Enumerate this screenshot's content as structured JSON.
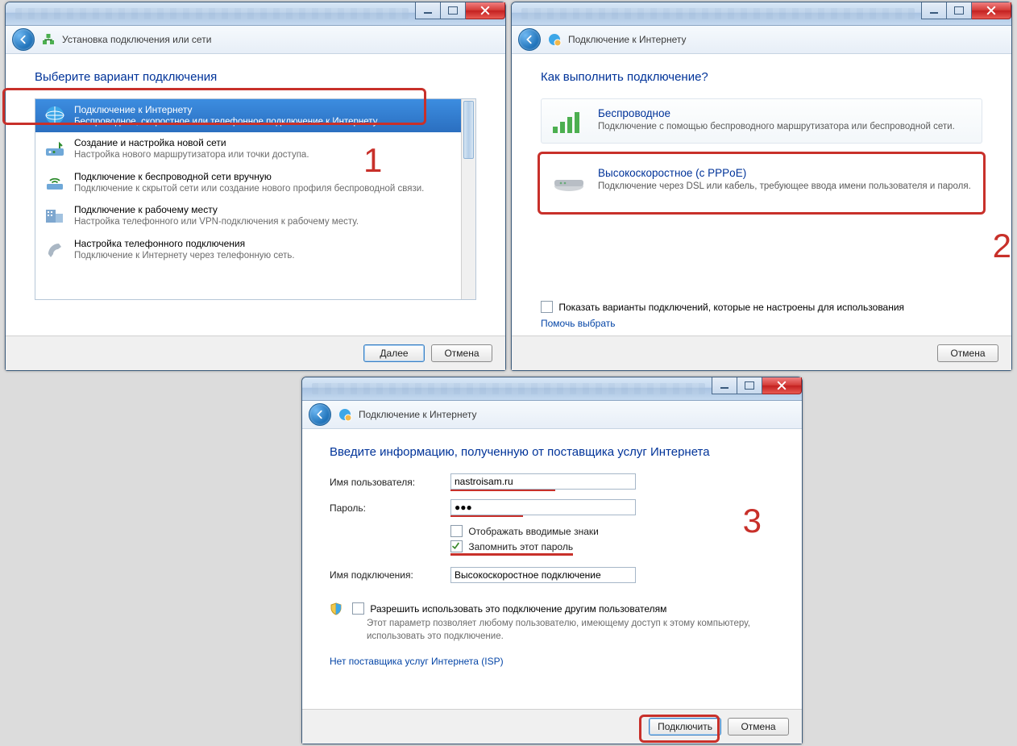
{
  "annotations": {
    "step1": "1",
    "step2": "2",
    "step3": "3"
  },
  "window1": {
    "header_title": "Установка подключения или сети",
    "heading": "Выберите вариант подключения",
    "options": [
      {
        "title": "Подключение к Интернету",
        "desc": "Беспроводное, скоростное или телефонное подключение к Интернету."
      },
      {
        "title": "Создание и настройка новой сети",
        "desc": "Настройка нового маршрутизатора или точки доступа."
      },
      {
        "title": "Подключение к беспроводной сети вручную",
        "desc": "Подключение к скрытой сети или создание нового профиля беспроводной связи."
      },
      {
        "title": "Подключение к рабочему месту",
        "desc": "Настройка телефонного или VPN-подключения к рабочему месту."
      },
      {
        "title": "Настройка телефонного подключения",
        "desc": "Подключение к Интернету через телефонную сеть."
      }
    ],
    "next": "Далее",
    "cancel": "Отмена"
  },
  "window2": {
    "header_title": "Подключение к Интернету",
    "heading": "Как выполнить подключение?",
    "wireless_title": "Беспроводное",
    "wireless_desc": "Подключение с помощью беспроводного маршрутизатора или беспроводной сети.",
    "pppoe_title": "Высокоскоростное (с PPPoE)",
    "pppoe_desc": "Подключение через DSL или кабель, требующее ввода имени пользователя и пароля.",
    "show_unconfigured": "Показать варианты подключений, которые не настроены для использования",
    "help_choose": "Помочь выбрать",
    "cancel": "Отмена"
  },
  "window3": {
    "header_title": "Подключение к Интернету",
    "heading": "Введите информацию, полученную от поставщика услуг Интернета",
    "label_user": "Имя пользователя:",
    "value_user": "nastroisam.ru",
    "label_pass": "Пароль:",
    "value_pass": "●●●",
    "show_chars": "Отображать вводимые знаки",
    "remember": "Запомнить этот пароль",
    "label_connname": "Имя подключения:",
    "value_connname": "Высокоскоростное подключение",
    "allow_others": "Разрешить использовать это подключение другим пользователям",
    "allow_others_desc": "Этот параметр позволяет любому пользователю, имеющему доступ к этому компьютеру, использовать это подключение.",
    "no_isp": "Нет поставщика услуг Интернета (ISP)",
    "connect": "Подключить",
    "cancel": "Отмена"
  }
}
